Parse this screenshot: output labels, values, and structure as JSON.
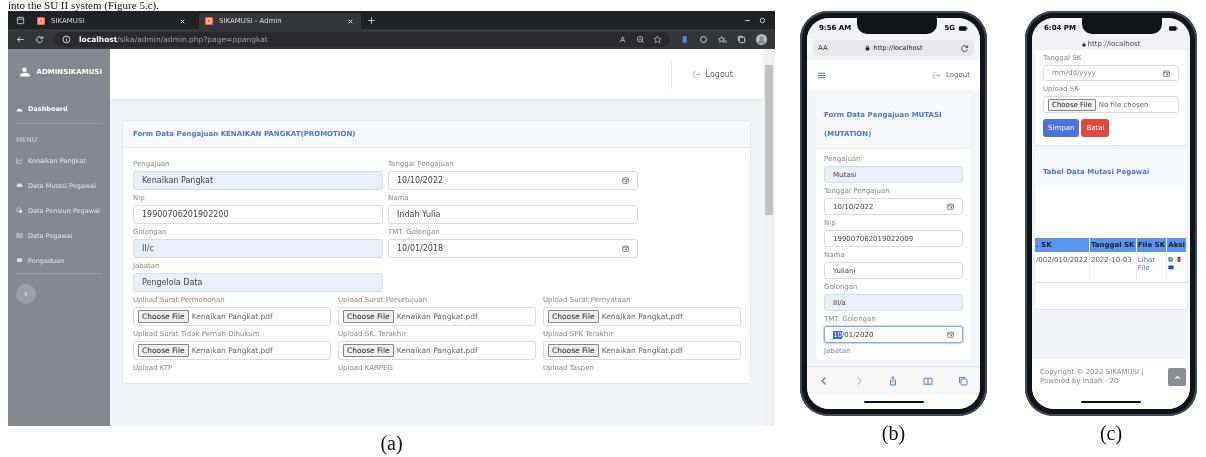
{
  "caption_text": "into the SU II system (Figure 5.c).",
  "desktop": {
    "tabs": [
      {
        "title": "SIKAMUSI",
        "selected": false
      },
      {
        "title": "SIKAMUSI - Admin",
        "selected": true
      }
    ],
    "url": {
      "host": "localhost",
      "path": "/sika/admin/admin.php?page=ppangkat"
    },
    "brand": "ADMINSIKAMUSI",
    "sidebar": [
      {
        "label": "Dashboard",
        "selected": true
      },
      {
        "label": "Kenaikan Pangkat",
        "selected": false
      },
      {
        "label": "Data Mutasi Pegawai",
        "selected": false
      },
      {
        "label": "Data Pensiun Pegawai",
        "selected": false
      },
      {
        "label": "Data Pegawai",
        "selected": false
      },
      {
        "label": "Pengaduan",
        "selected": false
      }
    ],
    "menu_heading": "MENU",
    "logout": "Logout",
    "form_title": "Form Data Pengajuan KENAIKAN PANGKAT(PROMOTION)",
    "field_rows": [
      [
        {
          "label": "Pengajuan",
          "value": "Kenaikan Pangkat",
          "kind": "text",
          "readonly": true
        },
        {
          "label": "Tanggal Pengajuan",
          "value": "10/10/2022",
          "kind": "date",
          "readonly": false
        }
      ],
      [
        {
          "label": "Nip",
          "value": "19900706201902200",
          "kind": "text",
          "readonly": false
        },
        {
          "label": "Nama",
          "value": "Indah Yulia",
          "kind": "text",
          "readonly": false
        }
      ],
      [
        {
          "label": "Golongan",
          "value": "II/c",
          "kind": "text",
          "readonly": true
        },
        {
          "label": "TMT. Golongan",
          "value": "10/01/2018",
          "kind": "date",
          "readonly": false
        }
      ],
      [
        {
          "label": "Jabatan",
          "value": "Pengelola Data",
          "kind": "text",
          "readonly": true
        }
      ]
    ],
    "uploads": [
      {
        "label": "Upload Surat Permohonan",
        "button": "Choose File",
        "file": "Kenaikan Pangkat.pdf"
      },
      {
        "label": "Upload Surat Persetujuan",
        "button": "Choose File",
        "file": "Kenaikan Pangkat.pdf"
      },
      {
        "label": "Upload Surat Pernyataan",
        "button": "Choose File",
        "file": "Kenaikan Pangkat.pdf"
      },
      {
        "label": "Upload Surat Tidak Pernah Dihukum",
        "button": "Choose File",
        "file": "Kenaikan Pangkat.pdf"
      },
      {
        "label": "Upload SK. Terakhir",
        "button": "Choose File",
        "file": "Kenaikan Pangkat.pdf"
      },
      {
        "label": "Upload SPK Terakhir",
        "button": "Choose File",
        "file": "Kenaikan Pangkat.pdf"
      },
      {
        "label": "Upload KTP"
      },
      {
        "label": "Upload KARPEG"
      },
      {
        "label": "Upload Taspen"
      }
    ],
    "caption": "(a)"
  },
  "phone_mutation": {
    "time": "9:56 AM",
    "network": "5G",
    "text_size": "AA",
    "url": "http://localhost",
    "logout": "Logout",
    "form_title": "Form Data Pengajuan MUTASI (MUTATION)",
    "fields": [
      {
        "label": "Pengajuan",
        "value": "Mutasi",
        "kind": "text",
        "readonly": true,
        "focused": false
      },
      {
        "label": "Tanggal Pengajuan",
        "value": "10/10/2022",
        "kind": "date",
        "readonly": false,
        "focused": false
      },
      {
        "label": "Nip",
        "value": "199007062019022009",
        "kind": "text",
        "readonly": false,
        "focused": false
      },
      {
        "label": "Nama",
        "value": "Yuliani",
        "kind": "text",
        "readonly": false,
        "focused": false
      },
      {
        "label": "Golongan",
        "value": "III/a",
        "kind": "text",
        "readonly": true,
        "focused": false
      },
      {
        "label": "TMT. Golongan",
        "value_selected": "10",
        "value": "/01/2020",
        "kind": "date",
        "readonly": false,
        "focused": true
      }
    ],
    "next_label": "Jabatan",
    "caption": "(b)"
  },
  "phone_table": {
    "time": "6:04 PM",
    "url": "http://localhost",
    "fields": [
      {
        "label": "Tanggal SK",
        "placeholder": "mm/dd/yyyy",
        "kind": "date"
      },
      {
        "label": "Upload SK",
        "button": "Choose File",
        "file": "No file chosen",
        "kind": "file"
      }
    ],
    "buttons": [
      {
        "label": "Simpan",
        "kind": "primary"
      },
      {
        "label": "Batal",
        "kind": "danger"
      }
    ],
    "table_title": "Tabel Data Mutasi Pegawai",
    "table": {
      "columns": [
        ". SK",
        "Tanggal SK",
        "File SK",
        "Aksi"
      ],
      "rows": [
        {
          "cells": [
            "/002/010/2022",
            "2022-10-03"
          ],
          "link": "Lihat File"
        }
      ]
    },
    "footer": "Copyright © 2022 SIKAMUSI | Powered by Indah - 20",
    "caption": "(c)"
  }
}
